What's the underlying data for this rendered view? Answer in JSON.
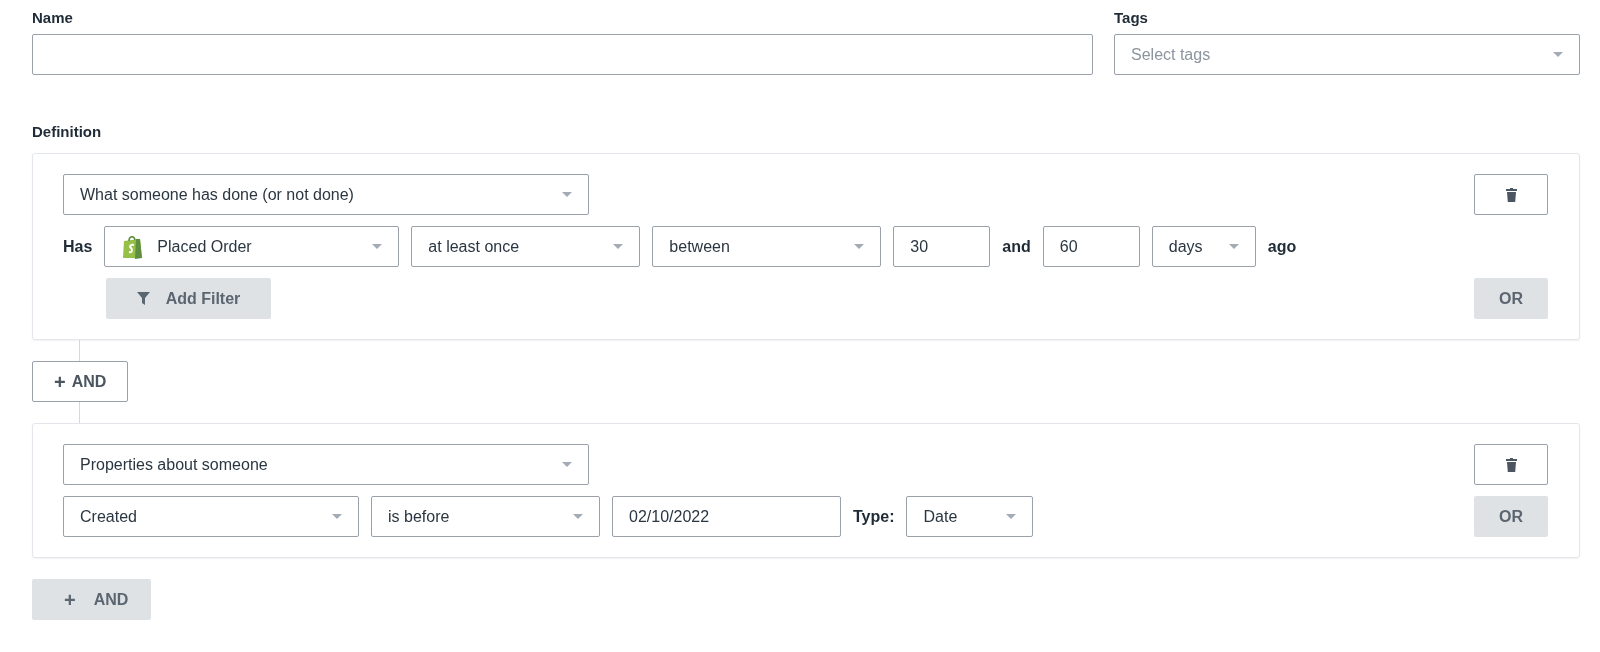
{
  "name_field": {
    "label": "Name"
  },
  "tags_field": {
    "label": "Tags",
    "placeholder": "Select tags"
  },
  "definition": {
    "label": "Definition",
    "conditions": [
      {
        "type_select": "What someone has done (or not done)",
        "row": [
          {
            "kind": "label",
            "text": "Has"
          },
          {
            "kind": "event",
            "text": "Placed Order"
          },
          {
            "kind": "select",
            "text": "at least once"
          },
          {
            "kind": "select",
            "text": "between"
          },
          {
            "kind": "input",
            "text": "30"
          },
          {
            "kind": "label",
            "text": "and"
          },
          {
            "kind": "input",
            "text": "60"
          },
          {
            "kind": "select",
            "text": "days"
          },
          {
            "kind": "label",
            "text": "ago"
          }
        ],
        "add_filter": "Add Filter",
        "or_button": "OR"
      },
      {
        "type_select": "Properties about someone",
        "row": [
          {
            "kind": "select",
            "text": "Created"
          },
          {
            "kind": "select",
            "text": "is before"
          },
          {
            "kind": "input",
            "text": "02/10/2022"
          },
          {
            "kind": "label",
            "text": "Type:"
          },
          {
            "kind": "select",
            "text": "Date"
          }
        ],
        "or_button": "OR"
      }
    ],
    "and_buttons": [
      {
        "icon": "+",
        "label": "AND",
        "filled": false
      },
      {
        "icon": "+",
        "label": "AND",
        "filled": true
      }
    ]
  }
}
